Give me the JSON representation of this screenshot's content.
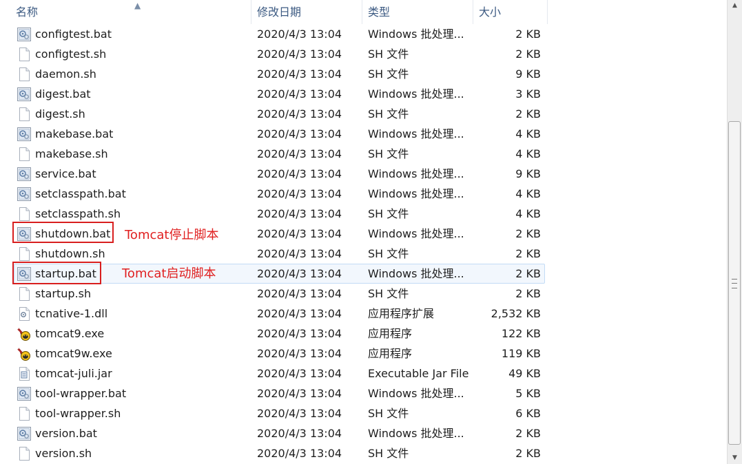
{
  "columns": {
    "name": "名称",
    "date": "修改日期",
    "type": "类型",
    "size": "大小"
  },
  "files": [
    {
      "name": "configtest.bat",
      "date": "2020/4/3 13:04",
      "type": "Windows 批处理...",
      "size": "2 KB",
      "icon": "batch-file-icon"
    },
    {
      "name": "configtest.sh",
      "date": "2020/4/3 13:04",
      "type": "SH 文件",
      "size": "2 KB",
      "icon": "blank-file-icon"
    },
    {
      "name": "daemon.sh",
      "date": "2020/4/3 13:04",
      "type": "SH 文件",
      "size": "9 KB",
      "icon": "blank-file-icon"
    },
    {
      "name": "digest.bat",
      "date": "2020/4/3 13:04",
      "type": "Windows 批处理...",
      "size": "3 KB",
      "icon": "batch-file-icon"
    },
    {
      "name": "digest.sh",
      "date": "2020/4/3 13:04",
      "type": "SH 文件",
      "size": "2 KB",
      "icon": "blank-file-icon"
    },
    {
      "name": "makebase.bat",
      "date": "2020/4/3 13:04",
      "type": "Windows 批处理...",
      "size": "4 KB",
      "icon": "batch-file-icon"
    },
    {
      "name": "makebase.sh",
      "date": "2020/4/3 13:04",
      "type": "SH 文件",
      "size": "4 KB",
      "icon": "blank-file-icon"
    },
    {
      "name": "service.bat",
      "date": "2020/4/3 13:04",
      "type": "Windows 批处理...",
      "size": "9 KB",
      "icon": "batch-file-icon"
    },
    {
      "name": "setclasspath.bat",
      "date": "2020/4/3 13:04",
      "type": "Windows 批处理...",
      "size": "4 KB",
      "icon": "batch-file-icon"
    },
    {
      "name": "setclasspath.sh",
      "date": "2020/4/3 13:04",
      "type": "SH 文件",
      "size": "4 KB",
      "icon": "blank-file-icon"
    },
    {
      "name": "shutdown.bat",
      "date": "2020/4/3 13:04",
      "type": "Windows 批处理...",
      "size": "2 KB",
      "icon": "batch-file-icon"
    },
    {
      "name": "shutdown.sh",
      "date": "2020/4/3 13:04",
      "type": "SH 文件",
      "size": "2 KB",
      "icon": "blank-file-icon"
    },
    {
      "name": "startup.bat",
      "date": "2020/4/3 13:04",
      "type": "Windows 批处理...",
      "size": "2 KB",
      "icon": "batch-file-icon"
    },
    {
      "name": "startup.sh",
      "date": "2020/4/3 13:04",
      "type": "SH 文件",
      "size": "2 KB",
      "icon": "blank-file-icon"
    },
    {
      "name": "tcnative-1.dll",
      "date": "2020/4/3 13:04",
      "type": "应用程序扩展",
      "size": "2,532 KB",
      "icon": "dll-file-icon"
    },
    {
      "name": "tomcat9.exe",
      "date": "2020/4/3 13:04",
      "type": "应用程序",
      "size": "122 KB",
      "icon": "tomcat-exe-icon"
    },
    {
      "name": "tomcat9w.exe",
      "date": "2020/4/3 13:04",
      "type": "应用程序",
      "size": "119 KB",
      "icon": "tomcat-exe-icon"
    },
    {
      "name": "tomcat-juli.jar",
      "date": "2020/4/3 13:04",
      "type": "Executable Jar File",
      "size": "49 KB",
      "icon": "jar-file-icon"
    },
    {
      "name": "tool-wrapper.bat",
      "date": "2020/4/3 13:04",
      "type": "Windows 批处理...",
      "size": "5 KB",
      "icon": "batch-file-icon"
    },
    {
      "name": "tool-wrapper.sh",
      "date": "2020/4/3 13:04",
      "type": "SH 文件",
      "size": "6 KB",
      "icon": "blank-file-icon"
    },
    {
      "name": "version.bat",
      "date": "2020/4/3 13:04",
      "type": "Windows 批处理...",
      "size": "2 KB",
      "icon": "batch-file-icon"
    },
    {
      "name": "version.sh",
      "date": "2020/4/3 13:04",
      "type": "SH 文件",
      "size": "2 KB",
      "icon": "blank-file-icon"
    }
  ],
  "selected_file": "startup.bat",
  "annotations": {
    "shutdown": "Tomcat停止脚本",
    "startup": "Tomcat启动脚本"
  },
  "colors": {
    "annotation": "#e02020",
    "header_text": "#3c5a82",
    "selection_border": "#c2dbf5",
    "selection_fill": "#f2f7fd"
  }
}
